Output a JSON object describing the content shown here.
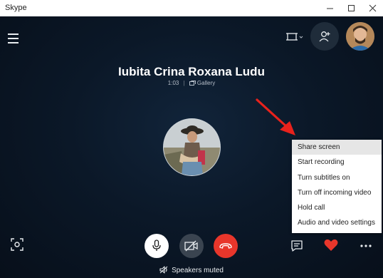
{
  "window": {
    "title": "Skype"
  },
  "call": {
    "caller_name": "Iubita Crina Roxana Ludu",
    "duration": "1:03",
    "separator": "|",
    "view_label": "Gallery"
  },
  "context_menu": {
    "items": [
      {
        "label": "Share screen",
        "highlighted": true
      },
      {
        "label": "Start recording"
      },
      {
        "label": "Turn subtitles on"
      },
      {
        "label": "Turn off incoming video"
      },
      {
        "label": "Hold call"
      },
      {
        "label": "Audio and video settings"
      }
    ]
  },
  "status": {
    "text": "Speakers muted"
  },
  "colors": {
    "background": "#0b1828",
    "end_call": "#e8362b",
    "heart": "#e8362b",
    "annotation_arrow": "#e8221c"
  },
  "icons": {
    "menu": "hamburger-icon",
    "layout": "layout-switch-icon",
    "add_participant": "add-person-icon",
    "gallery": "gallery-icon",
    "scan": "scan-icon",
    "mic": "microphone-icon",
    "video": "video-off-icon",
    "end_call": "hang-up-icon",
    "chat": "chat-icon",
    "heart": "heart-icon",
    "more": "more-dots-icon",
    "speaker_muted": "speaker-muted-icon"
  }
}
